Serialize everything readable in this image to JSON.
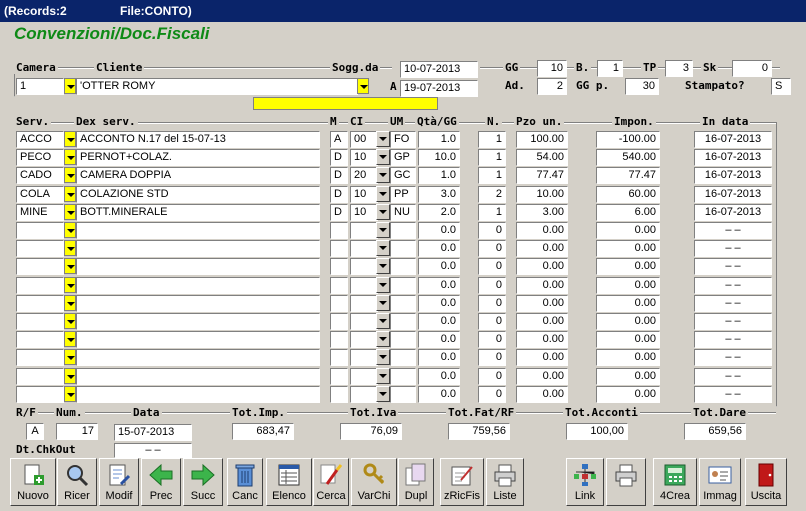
{
  "titlebar": {
    "records": "(Records:2",
    "file": "File:CONTO)"
  },
  "heading": "Convenzioni/Doc.Fiscali",
  "labels": {
    "camera": "Camera",
    "cliente": "Cliente",
    "sogg_da": "Sogg.da",
    "a": "A",
    "gg": "GG",
    "b": "B.",
    "tp": "TP",
    "sk": "Sk",
    "ad": "Ad.",
    "ggp": "GG p.",
    "stampato": "Stampato?"
  },
  "header": {
    "camera": "1",
    "cliente": "'OTTER ROMY",
    "sogg_da": "10-07-2013",
    "sogg_a": "19-07-2013",
    "gg": "10",
    "b": "1",
    "tp": "3",
    "sk": "0",
    "ad": "2",
    "ggp": "30",
    "stampato": "S"
  },
  "columns": {
    "serv": "Serv.",
    "dex": "Dex serv.",
    "m": "M",
    "ci": "CI",
    "um": "UM",
    "qta": "Qtà/GG",
    "n": "N.",
    "pzo": "Pzo un.",
    "impon": "Impon.",
    "indata": "In data"
  },
  "rows": [
    {
      "serv": "ACCO",
      "dex": "ACCONTO       N.17 del 15-07-13",
      "m": "A",
      "ci": "00",
      "um": "FO",
      "qta": "1.0",
      "n": "1",
      "pzo": "100.00",
      "impon": "-100.00",
      "indata": "16-07-2013"
    },
    {
      "serv": "PECO",
      "dex": "PERNOT+COLAZ.",
      "m": "D",
      "ci": "10",
      "um": "GP",
      "qta": "10.0",
      "n": "1",
      "pzo": "54.00",
      "impon": "540.00",
      "indata": "16-07-2013"
    },
    {
      "serv": "CADO",
      "dex": "CAMERA DOPPIA",
      "m": "D",
      "ci": "20",
      "um": "GC",
      "qta": "1.0",
      "n": "1",
      "pzo": "77.47",
      "impon": "77.47",
      "indata": "16-07-2013"
    },
    {
      "serv": "COLA",
      "dex": "COLAZIONE STD",
      "m": "D",
      "ci": "10",
      "um": "PP",
      "qta": "3.0",
      "n": "2",
      "pzo": "10.00",
      "impon": "60.00",
      "indata": "16-07-2013"
    },
    {
      "serv": "MINE",
      "dex": "BOTT.MINERALE",
      "m": "D",
      "ci": "10",
      "um": "NU",
      "qta": "2.0",
      "n": "1",
      "pzo": "3.00",
      "impon": "6.00",
      "indata": "16-07-2013"
    },
    {
      "serv": "",
      "dex": "",
      "m": "",
      "ci": "",
      "um": "",
      "qta": "0.0",
      "n": "0",
      "pzo": "0.00",
      "impon": "0.00",
      "indata": "–   –"
    },
    {
      "serv": "",
      "dex": "",
      "m": "",
      "ci": "",
      "um": "",
      "qta": "0.0",
      "n": "0",
      "pzo": "0.00",
      "impon": "0.00",
      "indata": "–   –"
    },
    {
      "serv": "",
      "dex": "",
      "m": "",
      "ci": "",
      "um": "",
      "qta": "0.0",
      "n": "0",
      "pzo": "0.00",
      "impon": "0.00",
      "indata": "–   –"
    },
    {
      "serv": "",
      "dex": "",
      "m": "",
      "ci": "",
      "um": "",
      "qta": "0.0",
      "n": "0",
      "pzo": "0.00",
      "impon": "0.00",
      "indata": "–   –"
    },
    {
      "serv": "",
      "dex": "",
      "m": "",
      "ci": "",
      "um": "",
      "qta": "0.0",
      "n": "0",
      "pzo": "0.00",
      "impon": "0.00",
      "indata": "–   –"
    },
    {
      "serv": "",
      "dex": "",
      "m": "",
      "ci": "",
      "um": "",
      "qta": "0.0",
      "n": "0",
      "pzo": "0.00",
      "impon": "0.00",
      "indata": "–   –"
    },
    {
      "serv": "",
      "dex": "",
      "m": "",
      "ci": "",
      "um": "",
      "qta": "0.0",
      "n": "0",
      "pzo": "0.00",
      "impon": "0.00",
      "indata": "–   –"
    },
    {
      "serv": "",
      "dex": "",
      "m": "",
      "ci": "",
      "um": "",
      "qta": "0.0",
      "n": "0",
      "pzo": "0.00",
      "impon": "0.00",
      "indata": "–   –"
    },
    {
      "serv": "",
      "dex": "",
      "m": "",
      "ci": "",
      "um": "",
      "qta": "0.0",
      "n": "0",
      "pzo": "0.00",
      "impon": "0.00",
      "indata": "–   –"
    },
    {
      "serv": "",
      "dex": "",
      "m": "",
      "ci": "",
      "um": "",
      "qta": "0.0",
      "n": "0",
      "pzo": "0.00",
      "impon": "0.00",
      "indata": "–   –"
    }
  ],
  "footer": {
    "labels": {
      "rf": "R/F",
      "num": "Num.",
      "data": "Data",
      "tot_imp": "Tot.Imp.",
      "tot_iva": "Tot.Iva",
      "tot_fat": "Tot.Fat/RF",
      "tot_acconti": "Tot.Acconti",
      "tot_dare": "Tot.Dare",
      "dt_chkout": "Dt.ChkOut"
    },
    "rf": "A",
    "num": "17",
    "data": "15-07-2013",
    "tot_imp": "683,47",
    "tot_iva": "76,09",
    "tot_fat": "759,56",
    "tot_acconti": "100,00",
    "tot_dare": "659,56",
    "dt_chkout": "–   –"
  },
  "toolbar": [
    {
      "name": "nuovo",
      "label": "Nuovo",
      "icon": "new-document-icon"
    },
    {
      "name": "ricer",
      "label": "Ricer",
      "icon": "magnifier-icon"
    },
    {
      "name": "modif",
      "label": "Modif",
      "icon": "edit-document-icon"
    },
    {
      "name": "prec",
      "label": "Prec",
      "icon": "arrow-left-icon"
    },
    {
      "name": "succ",
      "label": "Succ",
      "icon": "arrow-right-icon"
    },
    {
      "name": "canc",
      "label": "Canc",
      "icon": "trash-icon"
    },
    {
      "name": "elenco",
      "label": "Elenco",
      "icon": "list-icon"
    },
    {
      "name": "cerca",
      "label": "Cerca",
      "icon": "brush-icon"
    },
    {
      "name": "varchi",
      "label": "VarChi",
      "icon": "keys-icon"
    },
    {
      "name": "dupl",
      "label": "Dupl",
      "icon": "copy-icon"
    },
    {
      "name": "zricfis",
      "label": "zRicFis",
      "icon": "pen-icon"
    },
    {
      "name": "liste",
      "label": "Liste",
      "icon": "printer-icon"
    },
    {
      "name": "link",
      "label": "Link",
      "icon": "network-icon"
    },
    {
      "name": "print",
      "label": "",
      "icon": "printer-icon"
    },
    {
      "name": "4crea",
      "label": "4Crea",
      "icon": "calc-icon"
    },
    {
      "name": "immag",
      "label": "Immag",
      "icon": "card-icon"
    },
    {
      "name": "uscita",
      "label": "Uscita",
      "icon": "exit-door-icon"
    }
  ]
}
